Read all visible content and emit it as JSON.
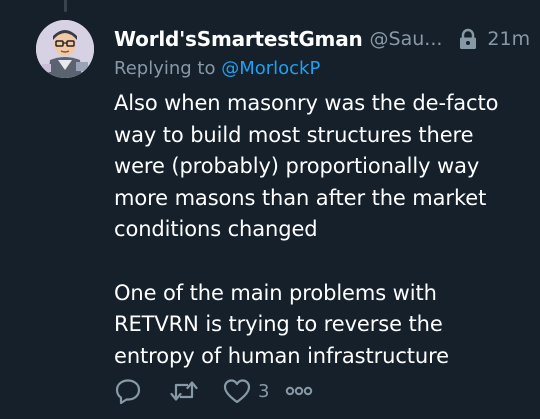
{
  "tweet": {
    "display_name": "World'sSmartestGman",
    "handle": "@Sau...",
    "time": "21m",
    "replying_prefix": "Replying to ",
    "replying_to": "@MorlockP",
    "paragraphs": [
      "Also when masonry was the de-facto way to build most structures there were (probably) proportionally way more masons than after the market conditions changed",
      "One of the main problems with RETVRN is trying to reverse the entropy of human infrastructure"
    ]
  },
  "actions": {
    "reply_icon": "speech-bubble-icon",
    "retweet_icon": "retweet-arrows-icon",
    "like_icon": "heart-icon",
    "like_count": "3",
    "more_icon": "three-dots-icon"
  },
  "icons": {
    "lock": "lock-icon"
  },
  "colors": {
    "background": "#15202b",
    "text": "#ffffff",
    "secondary": "#8899a6",
    "accent": "#1da1f2"
  }
}
